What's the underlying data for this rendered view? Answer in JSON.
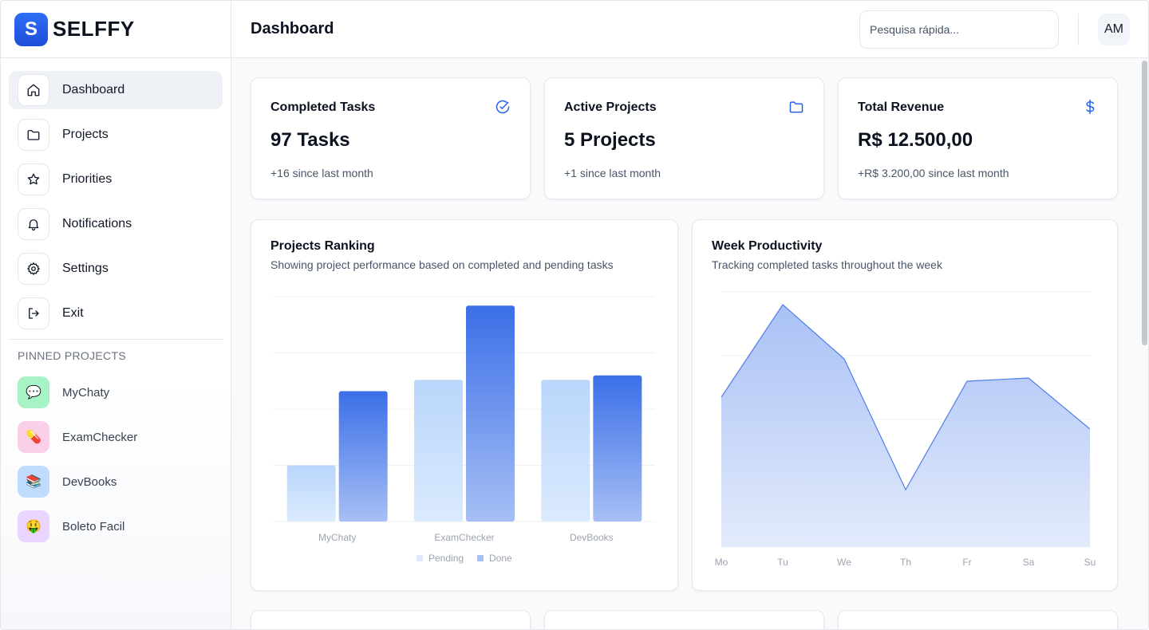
{
  "brand": {
    "logo_letter": "S",
    "name": "SELFFY",
    "color": "#2563eb"
  },
  "header": {
    "title": "Dashboard",
    "search_placeholder": "Pesquisa rápida...",
    "avatar_initials": "AM"
  },
  "sidebar": {
    "nav": [
      {
        "label": "Dashboard",
        "icon": "home-icon",
        "active": true
      },
      {
        "label": "Projects",
        "icon": "folder-icon"
      },
      {
        "label": "Priorities",
        "icon": "star-icon"
      },
      {
        "label": "Notifications",
        "icon": "bell-icon"
      },
      {
        "label": "Settings",
        "icon": "gear-icon"
      },
      {
        "label": "Exit",
        "icon": "logout-icon"
      }
    ],
    "pinned_title": "PINNED PROJECTS",
    "pinned": [
      {
        "label": "MyChaty",
        "emoji": "💬",
        "color": "#a7f3c5"
      },
      {
        "label": "ExamChecker",
        "emoji": "💊",
        "color": "#fbcfe8"
      },
      {
        "label": "DevBooks",
        "emoji": "📚",
        "color": "#bfdbfe"
      },
      {
        "label": "Boleto Facil",
        "emoji": "🤑",
        "color": "#e9d5ff"
      }
    ]
  },
  "stats": [
    {
      "title": "Completed Tasks",
      "value": "97 Tasks",
      "sub": "+16 since last month",
      "icon": "check-circle-icon"
    },
    {
      "title": "Active Projects",
      "value": "5 Projects",
      "sub": "+1 since last month",
      "icon": "folder-icon"
    },
    {
      "title": "Total Revenue",
      "value": "R$ 12.500,00",
      "sub": "+R$ 3.200,00 since last month",
      "icon": "dollar-icon"
    }
  ],
  "ranking": {
    "title": "Projects Ranking",
    "subtitle": "Showing project performance based on completed and pending tasks"
  },
  "productivity": {
    "title": "Week Productivity",
    "subtitle": "Tracking completed tasks throughout the week"
  },
  "chart_data": [
    {
      "type": "bar",
      "categories": [
        "MyChaty",
        "ExamChecker",
        "DevBooks"
      ],
      "series": [
        {
          "name": "Pending",
          "values": [
            25,
            63,
            63
          ],
          "color": "#bfdbfe"
        },
        {
          "name": "Done",
          "values": [
            58,
            96,
            65
          ],
          "color": "#3b6fe8"
        }
      ],
      "ylim": [
        0,
        100
      ],
      "grid": true,
      "legend": "bottom"
    },
    {
      "type": "area",
      "categories": [
        "Mo",
        "Tu",
        "We",
        "Th",
        "Fr",
        "Sa",
        "Su"
      ],
      "series": [
        {
          "values": [
            47,
            76,
            59,
            18,
            52,
            53,
            37
          ],
          "color": "#3b6fe8"
        }
      ],
      "ylim": [
        0,
        80
      ],
      "grid": true
    }
  ]
}
